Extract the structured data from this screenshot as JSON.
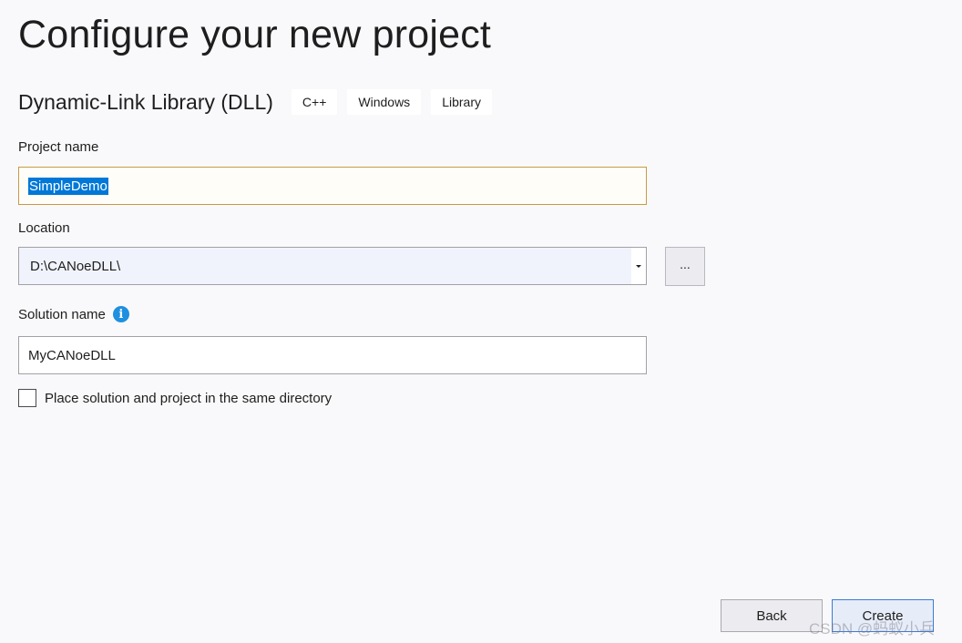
{
  "page": {
    "title": "Configure your new project"
  },
  "template": {
    "name": "Dynamic-Link Library (DLL)",
    "tags": [
      "C++",
      "Windows",
      "Library"
    ]
  },
  "project_name": {
    "label": "Project name",
    "value": "SimpleDemo",
    "focused": true,
    "text_selected": true
  },
  "location": {
    "label": "Location",
    "value": "D:\\CANoeDLL\\",
    "browse_label": "..."
  },
  "solution_name": {
    "label": "Solution name",
    "value": "MyCANoeDLL",
    "info_icon": "info-icon"
  },
  "same_directory": {
    "label": "Place solution and project in the same directory",
    "checked": false
  },
  "buttons": {
    "back": "Back",
    "create": "Create"
  },
  "watermark": "CSDN @蚂蚁小兵",
  "colors": {
    "background": "#f9f9fb",
    "focus_border": "#c89b46",
    "selection": "#0078d7",
    "info": "#1f8fe0",
    "primary_border": "#3a7bd5"
  }
}
